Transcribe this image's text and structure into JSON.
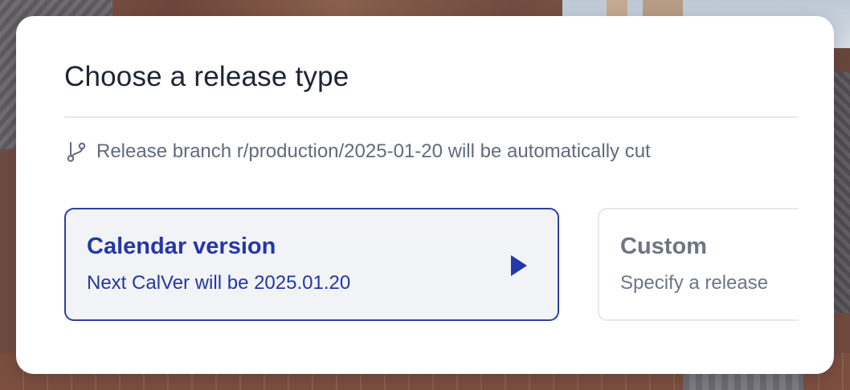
{
  "dialog": {
    "title": "Choose a release type",
    "info_icon": "git-branch-icon",
    "info_text": "Release branch r/production/2025-01-20 will be automatically cut",
    "options": [
      {
        "title": "Calendar version",
        "subtitle": "Next CalVer will be 2025.01.20",
        "selected": true,
        "icon": "play-icon"
      },
      {
        "title": "Custom",
        "subtitle": "Specify a release",
        "selected": false
      }
    ]
  },
  "colors": {
    "accent": "#2b3fa3",
    "selected_bg": "#f2f3f6",
    "muted_text": "#5f6b7c",
    "title_text": "#1d2433",
    "border": "#e6e8ec"
  }
}
